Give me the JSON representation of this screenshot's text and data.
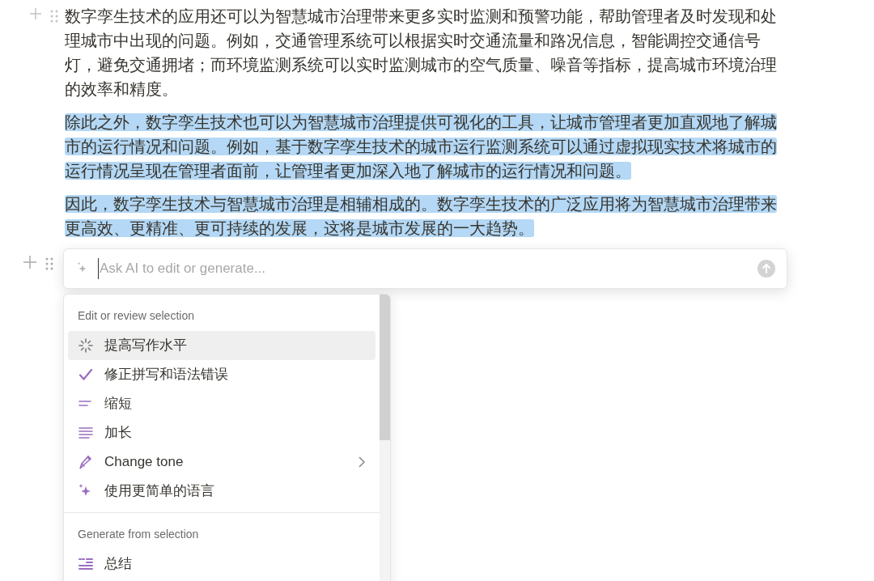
{
  "paragraphs": [
    {
      "selected": false,
      "lines": [
        "数字孪生技术的应用还可以为智慧城市治理带来更多实时监测和预警功能，帮助管理者及时发现和处",
        "理城市中出现的问题。例如，交通管理系统可以根据实时交通流量和路况信息，智能调控交通信号",
        "灯，避免交通拥堵；而环境监测系统可以实时监测城市的空气质量、噪音等指标，提高城市环境治理",
        "的效率和精度。"
      ]
    },
    {
      "selected": true,
      "lines": [
        "除此之外，数字孪生技术也可以为智慧城市治理提供可视化的工具，让城市管理者更加直观地了解城",
        "市的运行情况和问题。例如，基于数字孪生技术的城市运行监测系统可以通过虚拟现实技术将城市的",
        "运行情况呈现在管理者面前，让管理者更加深入地了解城市的运行情况和问题。"
      ]
    },
    {
      "selected": true,
      "lines": [
        "因此，数字孪生技术与智慧城市治理是相辅相成的。数字孪生技术的广泛应用将为智慧城市治理带来",
        "更高效、更精准、更可持续的发展，这将是城市发展的一大趋势。"
      ]
    }
  ],
  "ai_input": {
    "placeholder": "Ask AI to edit or generate..."
  },
  "menu": [
    {
      "heading": "Edit or review selection",
      "items": [
        {
          "kind": "sparkle-burst",
          "label": "提高写作水平",
          "selected": true,
          "submenu": false
        },
        {
          "kind": "check",
          "label": "修正拼写和语法错误",
          "selected": false,
          "submenu": false
        },
        {
          "kind": "short",
          "label": "缩短",
          "selected": false,
          "submenu": false
        },
        {
          "kind": "long",
          "label": "加长",
          "selected": false,
          "submenu": false
        },
        {
          "kind": "pen",
          "label": "Change tone",
          "selected": false,
          "submenu": true
        },
        {
          "kind": "sparkle",
          "label": "使用更简单的语言",
          "selected": false,
          "submenu": false
        }
      ]
    },
    {
      "heading": "Generate from selection",
      "items": [
        {
          "kind": "summary",
          "label": "总结",
          "selected": false,
          "submenu": false
        }
      ]
    }
  ]
}
